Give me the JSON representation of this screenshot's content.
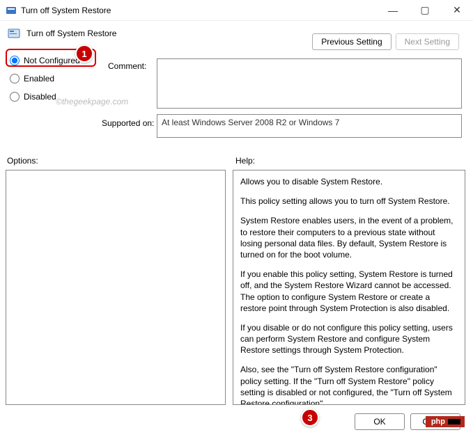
{
  "window": {
    "title": "Turn off System Restore",
    "min_icon": "—",
    "max_icon": "▢",
    "close_icon": "✕"
  },
  "header": {
    "policy_title": "Turn off System Restore",
    "prev_label": "Previous Setting",
    "next_label": "Next Setting"
  },
  "radios": {
    "not_configured": "Not Configured",
    "enabled": "Enabled",
    "disabled": "Disabled"
  },
  "labels": {
    "comment": "Comment:",
    "supported_on": "Supported on:",
    "options": "Options:",
    "help": "Help:"
  },
  "supported_text": "At least Windows Server 2008 R2 or Windows 7",
  "watermark": "©thegeekpage.com",
  "help_paragraphs": {
    "p0": "Allows you to disable System Restore.",
    "p1": "This policy setting allows you to turn off System Restore.",
    "p2": "System Restore enables users, in the event of a problem, to restore their computers to a previous state without losing personal data files. By default, System Restore is turned on for the boot volume.",
    "p3": "If you enable this policy setting, System Restore is turned off, and the System Restore Wizard cannot be accessed. The option to configure System Restore or create a restore point through System Protection is also disabled.",
    "p4": "If you disable or do not configure this policy setting, users can perform System Restore and configure System Restore settings through System Protection.",
    "p5": "Also, see the \"Turn off System Restore configuration\" policy setting. If the \"Turn off System Restore\" policy setting is disabled or not configured, the \"Turn off System Restore configuration\""
  },
  "callouts": {
    "c1": "1",
    "c3": "3"
  },
  "buttons": {
    "ok": "OK",
    "cancel": "Cancel"
  },
  "badge": "php"
}
